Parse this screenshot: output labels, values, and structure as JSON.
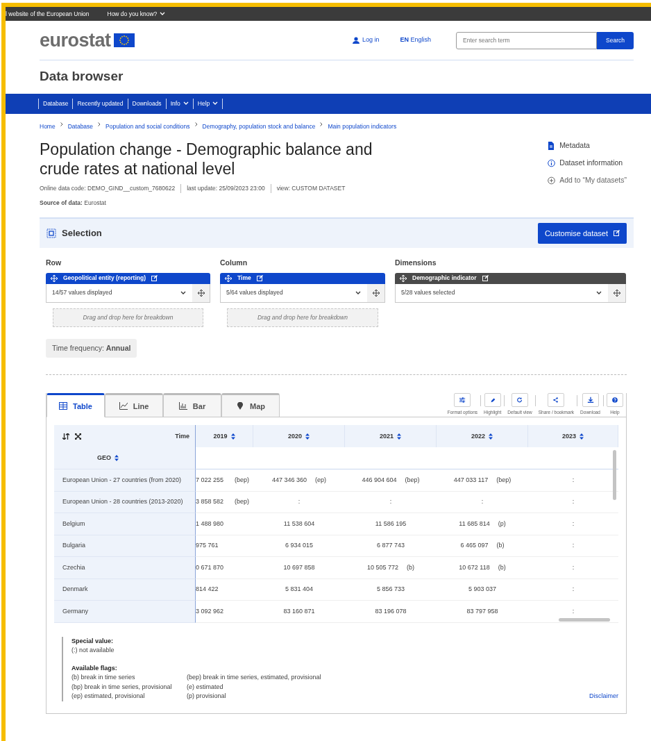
{
  "top_bar": {
    "site_note": "l website of the European Union",
    "how_link": "How do you know?"
  },
  "header": {
    "logo": "eurostat",
    "login": "Log in",
    "lang_code": "EN",
    "lang": "English",
    "search": {
      "placeholder": "Enter search term",
      "button": "Search"
    }
  },
  "app_title": "Data browser",
  "nav": [
    {
      "label": "Database",
      "dropdown": false
    },
    {
      "label": "Recently updated",
      "dropdown": false
    },
    {
      "label": "Downloads",
      "dropdown": false
    },
    {
      "label": "Info",
      "dropdown": true
    },
    {
      "label": "Help",
      "dropdown": true
    }
  ],
  "breadcrumb": [
    "Home",
    "Database",
    "Population and social conditions",
    "Demography, population stock and balance",
    "Main population indicators"
  ],
  "dataset": {
    "title": "Population change - Demographic balance and crude rates at national level",
    "meta": [
      "Online data code: DEMO_GIND__custom_7680622",
      "last update: 25/09/2023 23:00",
      "view: CUSTOM DATASET"
    ],
    "source_label": "Source of data:",
    "source": "Eurostat"
  },
  "actions": [
    {
      "label": "Metadata",
      "kind": "doc"
    },
    {
      "label": "Dataset information",
      "kind": "info"
    },
    {
      "label": "Add to “My datasets”",
      "kind": "add"
    }
  ],
  "selection": {
    "title": "Selection",
    "button": "Customise dataset",
    "groups": [
      {
        "heading": "Row",
        "dimension": "Geopolitical entity (reporting)",
        "value": "14/57 values displayed",
        "kind": "axis",
        "drop_hint": "Drag and drop here for breakdown"
      },
      {
        "heading": "Column",
        "dimension": "Time",
        "value": "5/64 values displayed",
        "kind": "axis",
        "drop_hint": "Drag and drop here for breakdown"
      },
      {
        "heading": "Dimensions",
        "dimension": "Demographic indicator",
        "value": "5/28 values selected",
        "kind": "filter"
      }
    ],
    "frequency_label": "Time frequency:",
    "frequency": "Annual"
  },
  "view_tabs": [
    {
      "label": "Table",
      "kind": "table",
      "selected": true
    },
    {
      "label": "Line",
      "kind": "line",
      "selected": false
    },
    {
      "label": "Bar",
      "kind": "bar",
      "selected": false
    },
    {
      "label": "Map",
      "kind": "map",
      "selected": false
    }
  ],
  "tools": [
    {
      "label": "Format options",
      "kind": "sliders"
    },
    {
      "label": "Highlight",
      "kind": "pen"
    },
    {
      "label": "Default view",
      "kind": "reset"
    },
    {
      "label": "Share / bookmark",
      "kind": "share"
    },
    {
      "label": "Download",
      "kind": "download"
    },
    {
      "label": "Help",
      "kind": "help"
    }
  ],
  "table": {
    "time_label": "Time",
    "geo_label": "GEO",
    "columns": [
      "2019",
      "2020",
      "2021",
      "2022",
      "2023"
    ],
    "rows": [
      {
        "geo": "European Union - 27 countries (from 2020)",
        "cells": [
          {
            "value": "7 022 255",
            "flag": "(bep)"
          },
          {
            "value": "447 346 360",
            "flag": "(ep)"
          },
          {
            "value": "446 904 604",
            "flag": "(bep)"
          },
          {
            "value": "447 033 117",
            "flag": "(bep)"
          },
          {
            "value": ":"
          }
        ]
      },
      {
        "geo": "European Union - 28 countries (2013-2020)",
        "cells": [
          {
            "value": "3 858 582",
            "flag": "(bep)"
          },
          {
            "value": ":"
          },
          {
            "value": ":"
          },
          {
            "value": ":"
          },
          {
            "value": ":"
          }
        ]
      },
      {
        "geo": "Belgium",
        "cells": [
          {
            "value": "1 488 980"
          },
          {
            "value": "11 538 604"
          },
          {
            "value": "11 586 195"
          },
          {
            "value": "11 685 814",
            "flag": "(p)"
          },
          {
            "value": ":"
          }
        ]
      },
      {
        "geo": "Bulgaria",
        "cells": [
          {
            "value": "975 761"
          },
          {
            "value": "6 934 015"
          },
          {
            "value": "6 877 743"
          },
          {
            "value": "6 465 097",
            "flag": "(b)"
          },
          {
            "value": ":"
          }
        ]
      },
      {
        "geo": "Czechia",
        "cells": [
          {
            "value": "0 671 870"
          },
          {
            "value": "10 697 858"
          },
          {
            "value": "10 505 772",
            "flag": "(b)"
          },
          {
            "value": "10 672 118",
            "flag": "(b)"
          },
          {
            "value": ":"
          }
        ]
      },
      {
        "geo": "Denmark",
        "cells": [
          {
            "value": "814 422"
          },
          {
            "value": "5 831 404"
          },
          {
            "value": "5 856 733"
          },
          {
            "value": "5 903 037"
          },
          {
            "value": ":"
          }
        ]
      },
      {
        "geo": "Germany",
        "cells": [
          {
            "value": "3 092 962"
          },
          {
            "value": "83 160 871"
          },
          {
            "value": "83 196 078"
          },
          {
            "value": "83 797 958"
          },
          {
            "value": ":"
          }
        ]
      }
    ]
  },
  "notes": {
    "special_title": "Special value:",
    "special": [
      "(:) not available"
    ],
    "flags_title": "Available flags:",
    "flags": [
      "(b) break in time series",
      "(bep) break in time series, estimated, provisional",
      "(bp) break in time series, provisional",
      "(e) estimated",
      "(ep) estimated, provisional",
      "(p) provisional"
    ],
    "disclaimer": "Disclaimer"
  }
}
